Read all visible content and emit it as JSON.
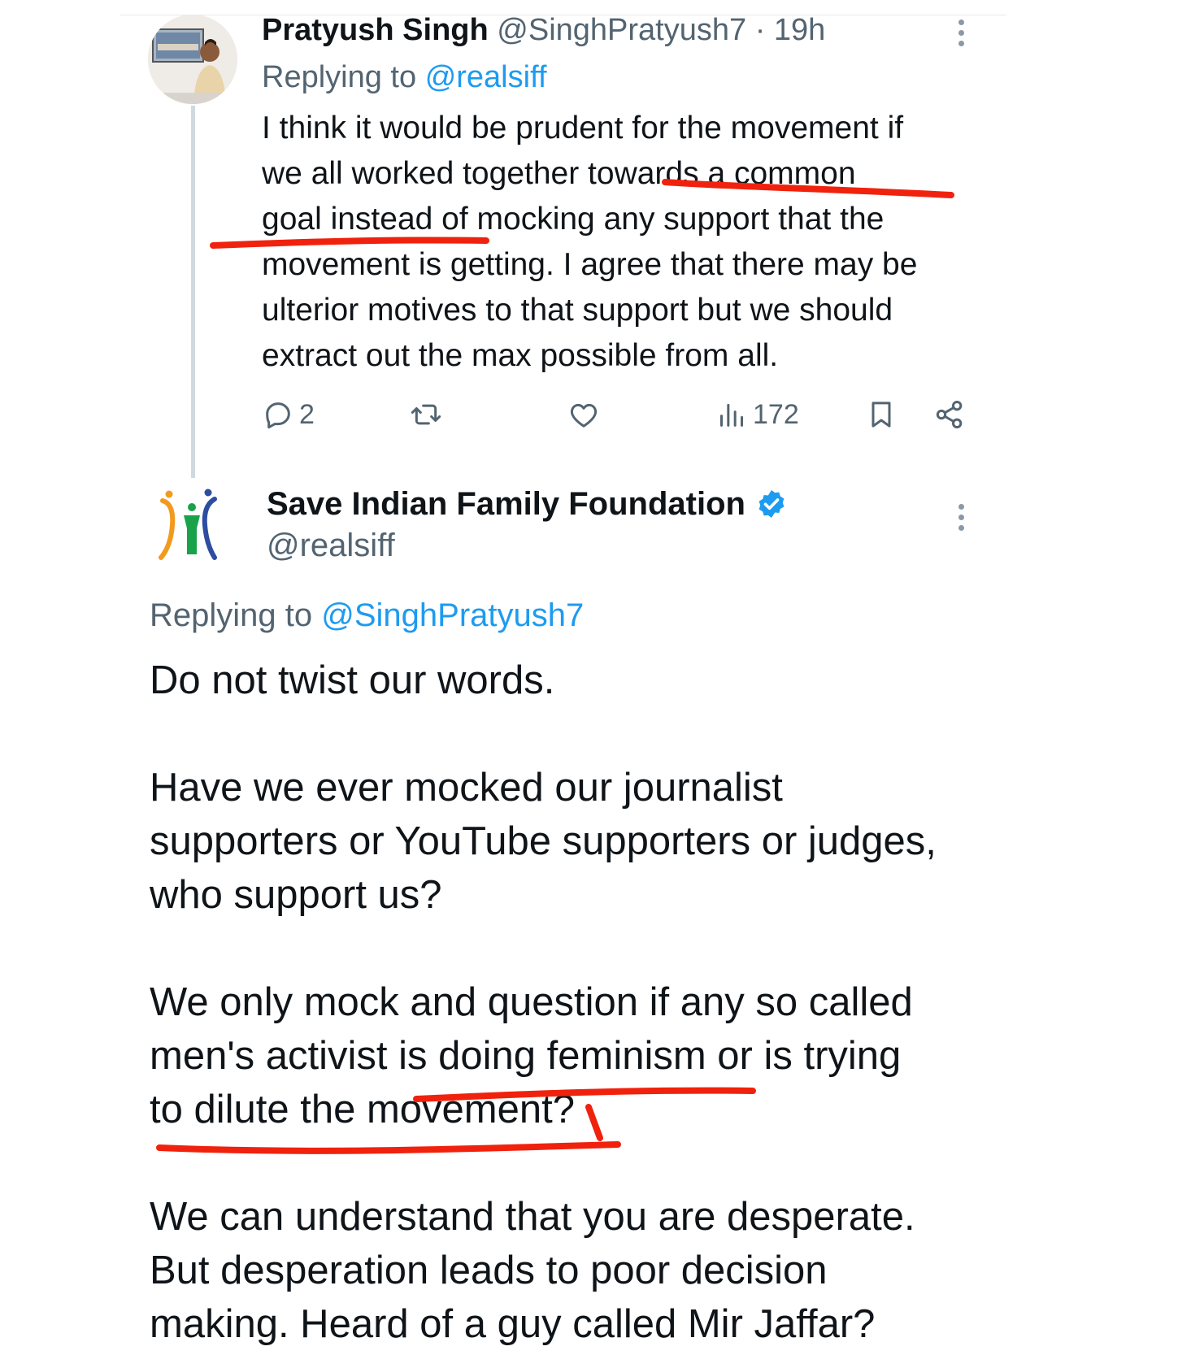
{
  "reply_tweet": {
    "author_name": "Pratyush Singh",
    "handle_time": "@SinghPratyush7 · 19h",
    "replying_prefix": "Replying to",
    "replying_to": "@realsiff",
    "body": "I think it would be prudent for the movement if\nwe all worked together towards a common\ngoal instead of mocking any support that the\nmovement is getting. I agree that there may be\nulterior motives to that support but we should\nextract out the max possible from all.",
    "actions": {
      "reply_count": "2",
      "retweet_count": "",
      "like_count": "",
      "views_count": "172"
    },
    "icons": [
      "more-icon",
      "reply-icon",
      "retweet-icon",
      "like-icon",
      "views-icon",
      "bookmark-icon",
      "share-icon"
    ]
  },
  "main_tweet": {
    "author_name": "Save Indian Family Foundation",
    "handle": "@realsiff",
    "verified": true,
    "replying_prefix": "Replying to",
    "replying_to": "@SinghPratyush7",
    "body": "Do not twist our words.\n\nHave we ever mocked our journalist\nsupporters or YouTube supporters or judges,\nwho support us?\n\nWe only mock and question if any so called\nmen's activist is doing feminism or is trying\nto dilute the movement?\n\nWe can understand that you are desperate.\nBut desperation leads to poor decision\nmaking. Heard of a guy called Mir Jaffar?"
  },
  "colors": {
    "text": "#0f1419",
    "muted": "#536471",
    "link": "#1d9bf0",
    "verified": "#1d9bf0",
    "annotation_red": "#f0220d"
  }
}
